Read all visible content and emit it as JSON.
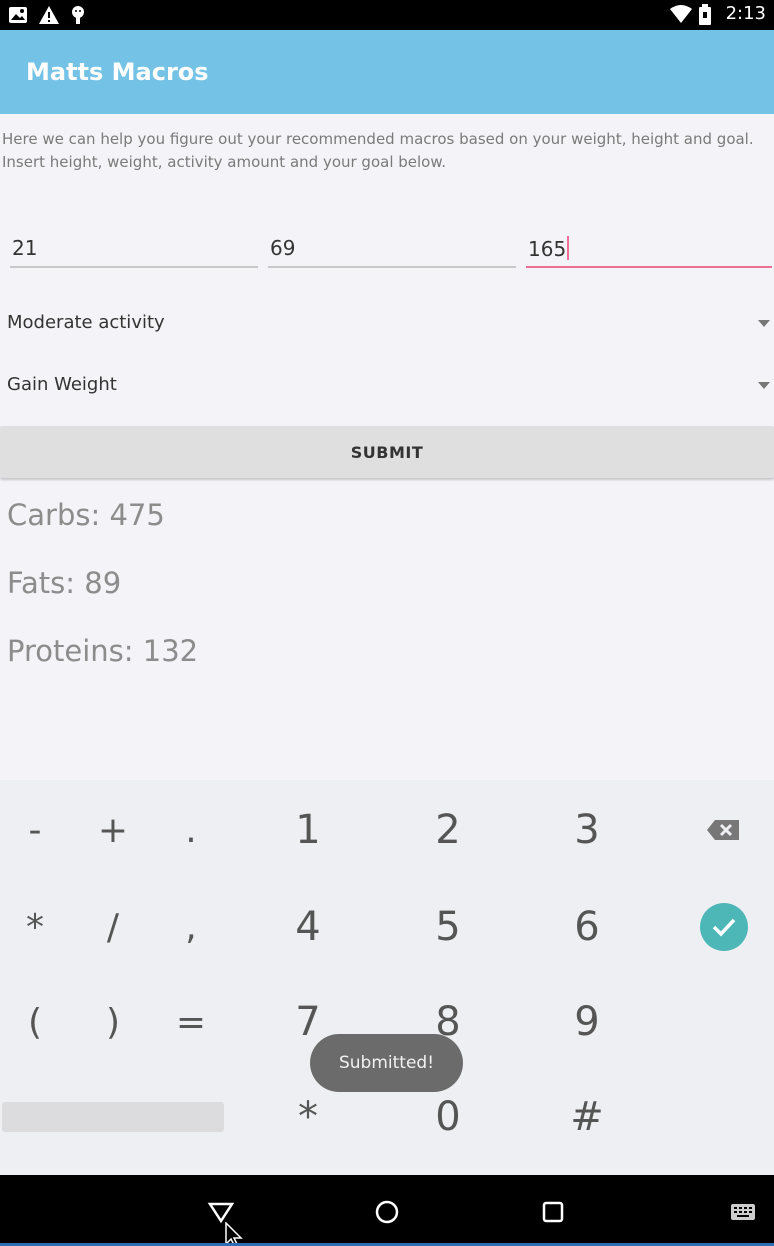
{
  "status_bar": {
    "time": "2:13",
    "icons": [
      "photo-notification-icon",
      "warning-icon",
      "android-debug-icon",
      "wifi-icon",
      "battery-icon"
    ]
  },
  "app_bar": {
    "title": "Matts Macros"
  },
  "intro_text": "Here we can help you figure out your recommended macros based on your weight, height and goal. Insert height, weight, activity amount and your goal below.",
  "inputs": {
    "age": {
      "value": "21"
    },
    "height": {
      "value": "69"
    },
    "weight": {
      "value": "165"
    }
  },
  "activity_spinner": {
    "selected": "Moderate activity"
  },
  "goal_spinner": {
    "selected": "Gain Weight"
  },
  "submit_button": {
    "label": "SUBMIT"
  },
  "results": {
    "carbs": "Carbs: 475",
    "fats": "Fats: 89",
    "proteins": "Proteins: 132"
  },
  "keyboard": {
    "row1": [
      "-",
      "+",
      ".",
      "1",
      "2",
      "3"
    ],
    "row2": [
      "*",
      "/",
      ",",
      "4",
      "5",
      "6"
    ],
    "row3": [
      "(",
      ")",
      "=",
      "7",
      "8",
      "9"
    ],
    "row4": [
      "*",
      "0",
      "#"
    ],
    "accent_color": "#4db6b6"
  },
  "toast": {
    "message": "Submitted!"
  },
  "colors": {
    "app_bar": "#74c3e6",
    "active_underline": "#ee6e96",
    "background": "#f4f3f7"
  }
}
